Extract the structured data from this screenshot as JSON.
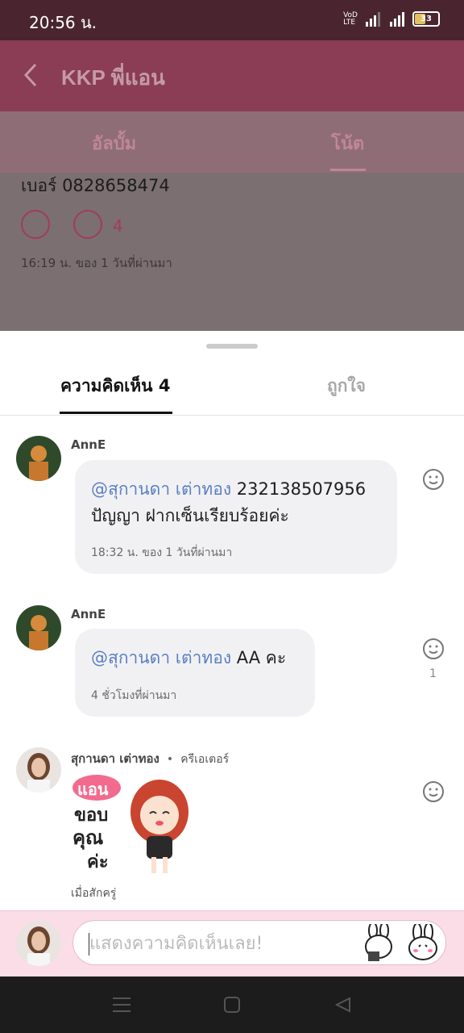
{
  "status_bar": {
    "time": "20:56 น.",
    "battery": "33"
  },
  "header": {
    "title": "KKP พี่แอน"
  },
  "tabs": [
    {
      "label": "อัลบั้ม"
    },
    {
      "label": "โน้ต"
    }
  ],
  "background_post": {
    "text": "เบอร์ 0828658474",
    "comment_count": "4",
    "time": "16:19 น. ของ 1 วันที่ผ่านมา"
  },
  "sheet": {
    "tab_comments": "ความคิดเห็น 4",
    "tab_likes": "ถูกใจ"
  },
  "comments": [
    {
      "author": "AnnE",
      "mention": "@สุกานดา เต่าทอง",
      "text_inline": "232138507956",
      "text_line2": "ปัญญา ฝากเซ็นเรียบร้อยค่ะ",
      "time": "18:32 น. ของ 1 วันที่ผ่านมา"
    },
    {
      "author": "AnnE",
      "mention": "@สุกานดา เต่าทอง",
      "text_inline": "AA คะ",
      "time": "4 ชั่วโมงที่ผ่านมา",
      "reaction_count": "1"
    },
    {
      "author": "สุกานดา เต่าทอง",
      "separator": "•",
      "role": "ครีเอเตอร์",
      "sticker_text1": "แอน",
      "sticker_text2": "ขอบ",
      "sticker_text3": "คุณ",
      "sticker_text4": "ค่ะ",
      "time": "เมื่อสักครู่"
    }
  ],
  "input": {
    "placeholder": "แสดงความคิดเห็นเลย!"
  }
}
